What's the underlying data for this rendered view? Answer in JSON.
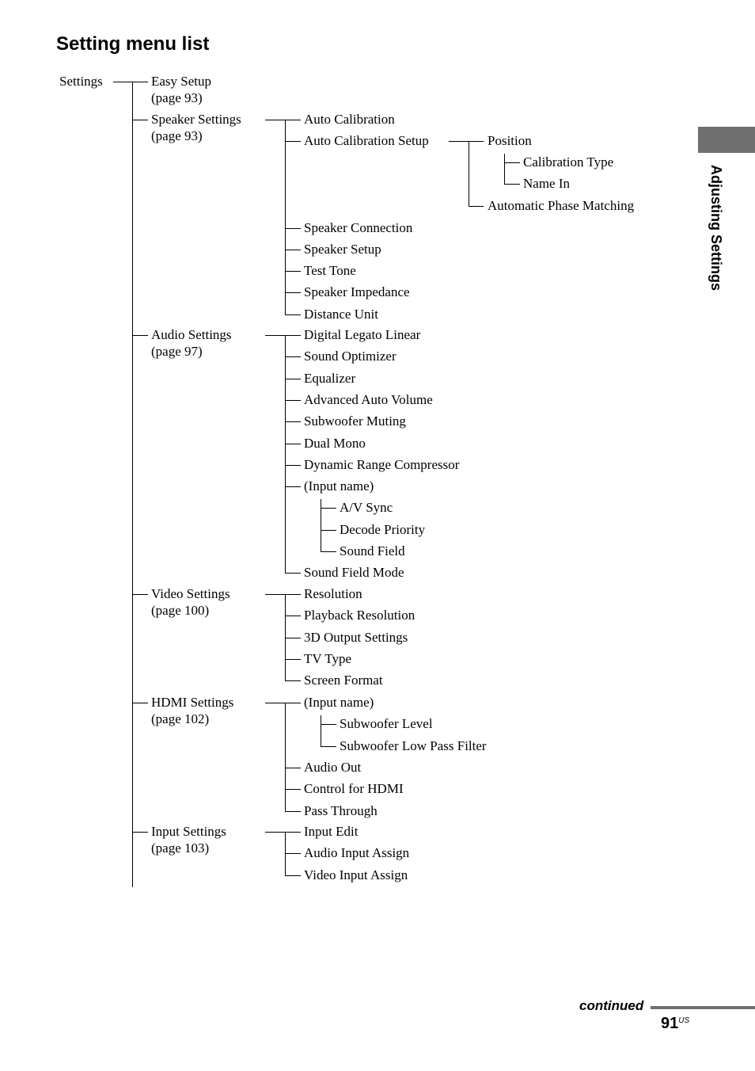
{
  "page": {
    "title": "Setting menu list",
    "side_label": "Adjusting Settings",
    "continued": "continued",
    "page_number": "91",
    "page_suffix": "US"
  },
  "tree": {
    "label": "Settings",
    "children": [
      {
        "label": "Easy Setup",
        "page": "(page 93)"
      },
      {
        "label": "Speaker Settings",
        "page": "(page 93)",
        "children": [
          {
            "label": "Auto Calibration"
          },
          {
            "label": "Auto Calibration Setup",
            "children": [
              {
                "label": "Position",
                "children": [
                  {
                    "label": "Calibration Type"
                  },
                  {
                    "label": "Name In"
                  }
                ]
              },
              {
                "label": "Automatic Phase Matching"
              }
            ]
          },
          {
            "label": "Speaker Connection"
          },
          {
            "label": "Speaker Setup"
          },
          {
            "label": "Test Tone"
          },
          {
            "label": "Speaker Impedance"
          },
          {
            "label": "Distance Unit"
          }
        ]
      },
      {
        "label": "Audio Settings",
        "page": "(page 97)",
        "children": [
          {
            "label": "Digital Legato Linear"
          },
          {
            "label": "Sound Optimizer"
          },
          {
            "label": "Equalizer"
          },
          {
            "label": "Advanced Auto Volume"
          },
          {
            "label": "Subwoofer Muting"
          },
          {
            "label": "Dual Mono"
          },
          {
            "label": "Dynamic Range Compressor"
          },
          {
            "label": "(Input name)",
            "children": [
              {
                "label": "A/V Sync"
              },
              {
                "label": "Decode Priority"
              },
              {
                "label": "Sound Field"
              }
            ]
          },
          {
            "label": "Sound Field Mode"
          }
        ]
      },
      {
        "label": "Video Settings",
        "page": "(page 100)",
        "children": [
          {
            "label": "Resolution"
          },
          {
            "label": "Playback Resolution"
          },
          {
            "label": "3D Output Settings"
          },
          {
            "label": "TV Type"
          },
          {
            "label": "Screen Format"
          }
        ]
      },
      {
        "label": "HDMI Settings",
        "page": "(page 102)",
        "children": [
          {
            "label": "(Input name)",
            "children": [
              {
                "label": "Subwoofer Level"
              },
              {
                "label": "Subwoofer Low Pass Filter"
              }
            ]
          },
          {
            "label": "Audio Out"
          },
          {
            "label": "Control for HDMI"
          },
          {
            "label": "Pass Through"
          }
        ]
      },
      {
        "label": "Input Settings",
        "page": "(page 103)",
        "children": [
          {
            "label": "Input Edit"
          },
          {
            "label": "Audio Input Assign"
          },
          {
            "label": "Video Input Assign"
          }
        ]
      }
    ]
  }
}
